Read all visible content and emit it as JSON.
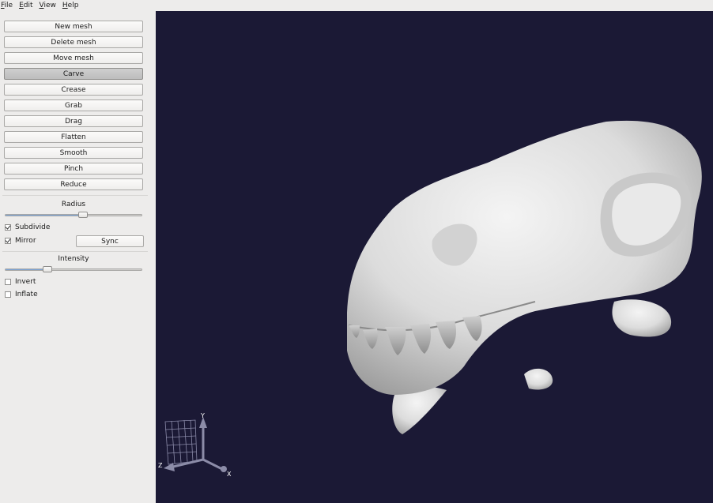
{
  "menu": {
    "items": [
      {
        "label": "File",
        "mnemonic": "F",
        "rest": "ile"
      },
      {
        "label": "Edit",
        "mnemonic": "E",
        "rest": "dit"
      },
      {
        "label": "View",
        "mnemonic": "V",
        "rest": "iew"
      },
      {
        "label": "Help",
        "mnemonic": "H",
        "rest": "elp"
      }
    ]
  },
  "tools": {
    "new_mesh": "New mesh",
    "delete_mesh": "Delete mesh",
    "move_mesh": "Move mesh",
    "carve": "Carve",
    "crease": "Crease",
    "grab": "Grab",
    "drag": "Drag",
    "flatten": "Flatten",
    "smooth": "Smooth",
    "pinch": "Pinch",
    "reduce": "Reduce",
    "active_tool": "Carve"
  },
  "radius": {
    "label": "Radius",
    "value_fraction": 0.57
  },
  "options": {
    "subdivide": {
      "label": "Subdivide",
      "checked": true
    },
    "mirror": {
      "label": "Mirror",
      "checked": true
    },
    "sync_label": "Sync"
  },
  "intensity": {
    "label": "Intensity",
    "value_fraction": 0.31
  },
  "extras": {
    "invert": {
      "label": "Invert",
      "checked": false
    },
    "inflate": {
      "label": "Inflate",
      "checked": false
    }
  },
  "axes": {
    "y": "Y",
    "z": "Z",
    "x": "X"
  },
  "colors": {
    "viewport_bg": "#1b1935",
    "mesh": "#e6e6e6",
    "slider_fill": "#7aa3d6"
  }
}
